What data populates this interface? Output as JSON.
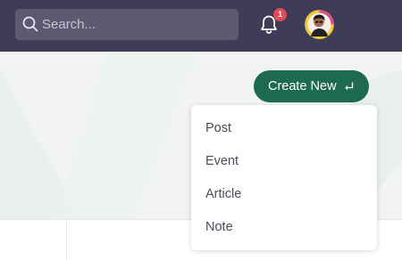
{
  "header": {
    "search": {
      "placeholder": "Search...",
      "value": ""
    },
    "notifications": {
      "count": "1",
      "icon": "bell-icon"
    },
    "avatar": {
      "icon": "user-avatar"
    }
  },
  "toolbar": {
    "create_label": "Create New",
    "create_icon": "enter-icon"
  },
  "create_menu": {
    "items": [
      {
        "label": "Post"
      },
      {
        "label": "Event"
      },
      {
        "label": "Article"
      },
      {
        "label": "Note"
      }
    ]
  },
  "colors": {
    "topbar": "#3e3c56",
    "search_bg": "#5b5a70",
    "primary_button": "#1e6a50",
    "badge": "#e04b55",
    "background": "#f1f4f2"
  }
}
